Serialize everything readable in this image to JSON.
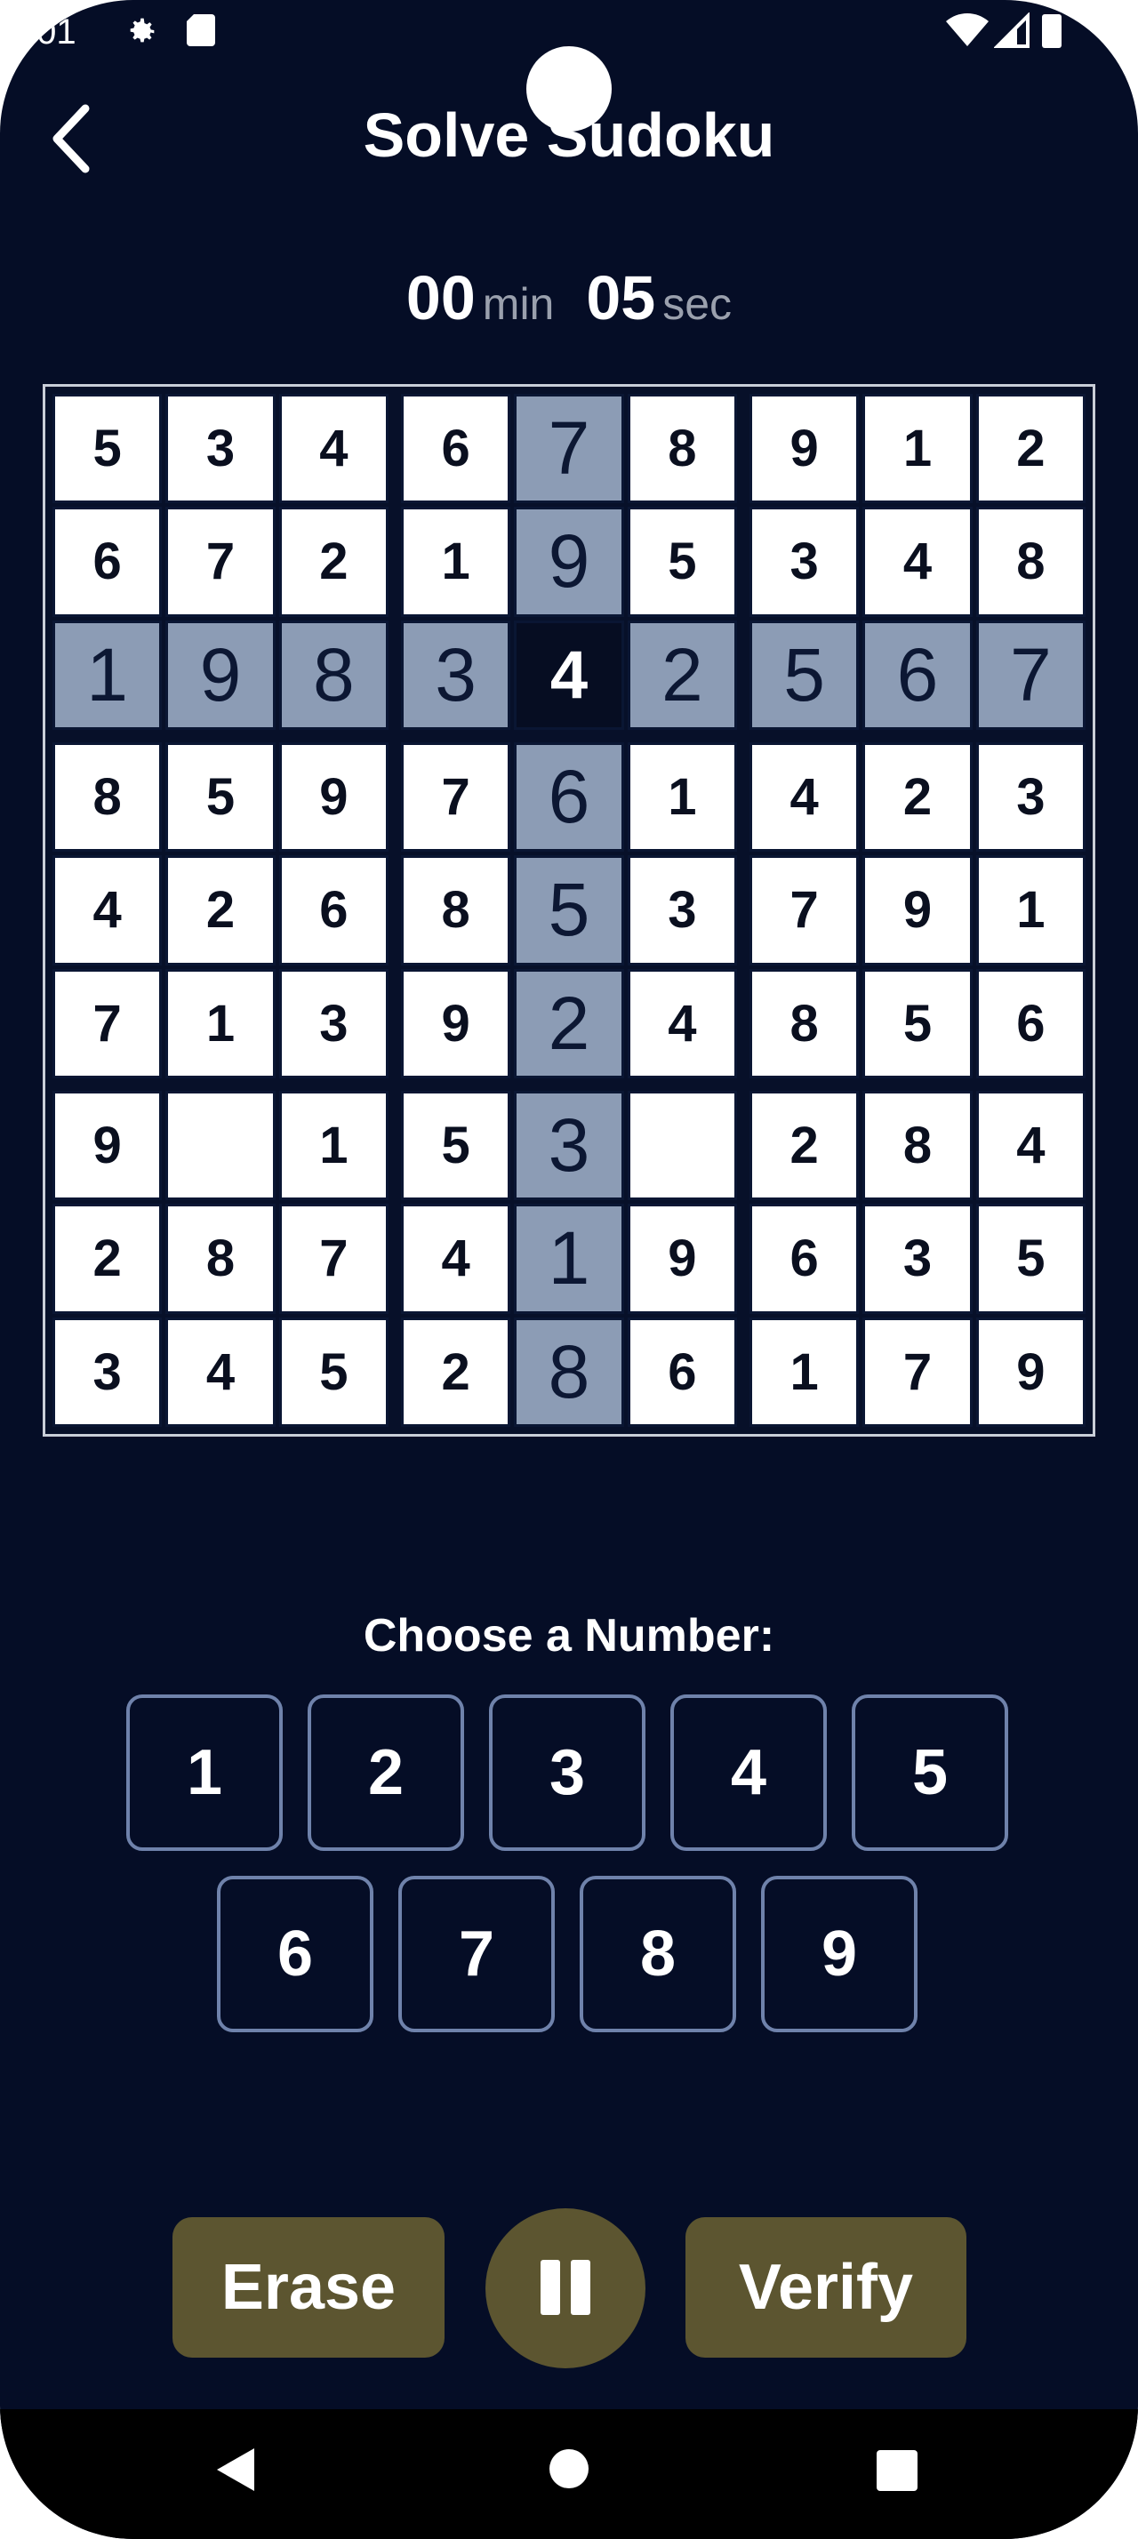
{
  "status_bar": {
    "time": ":01"
  },
  "header": {
    "title": "Solve Sudoku"
  },
  "timer": {
    "minutes": "00",
    "min_label": "min",
    "seconds": "05",
    "sec_label": "sec"
  },
  "board": {
    "rows": [
      [
        "5",
        "3",
        "4",
        "6",
        "7",
        "8",
        "9",
        "1",
        "2"
      ],
      [
        "6",
        "7",
        "2",
        "1",
        "9",
        "5",
        "3",
        "4",
        "8"
      ],
      [
        "1",
        "9",
        "8",
        "3",
        "4",
        "2",
        "5",
        "6",
        "7"
      ],
      [
        "8",
        "5",
        "9",
        "7",
        "6",
        "1",
        "4",
        "2",
        "3"
      ],
      [
        "4",
        "2",
        "6",
        "8",
        "5",
        "3",
        "7",
        "9",
        "1"
      ],
      [
        "7",
        "1",
        "3",
        "9",
        "2",
        "4",
        "8",
        "5",
        "6"
      ],
      [
        "9",
        "",
        "1",
        "5",
        "3",
        "",
        "2",
        "8",
        "4"
      ],
      [
        "2",
        "8",
        "7",
        "4",
        "1",
        "9",
        "6",
        "3",
        "5"
      ],
      [
        "3",
        "4",
        "5",
        "2",
        "8",
        "6",
        "1",
        "7",
        "9"
      ]
    ],
    "selected_row": 3,
    "selected_col": 5
  },
  "chooser": {
    "label": "Choose a Number:",
    "numbers": [
      "1",
      "2",
      "3",
      "4",
      "5",
      "6",
      "7",
      "8",
      "9"
    ]
  },
  "actions": {
    "erase": "Erase",
    "verify": "Verify"
  },
  "colors": {
    "background": "#050d26",
    "highlight": "#8c9cb5",
    "selected": "#060d22",
    "action_button": "#5c5530",
    "number_border": "#6f82ab"
  }
}
